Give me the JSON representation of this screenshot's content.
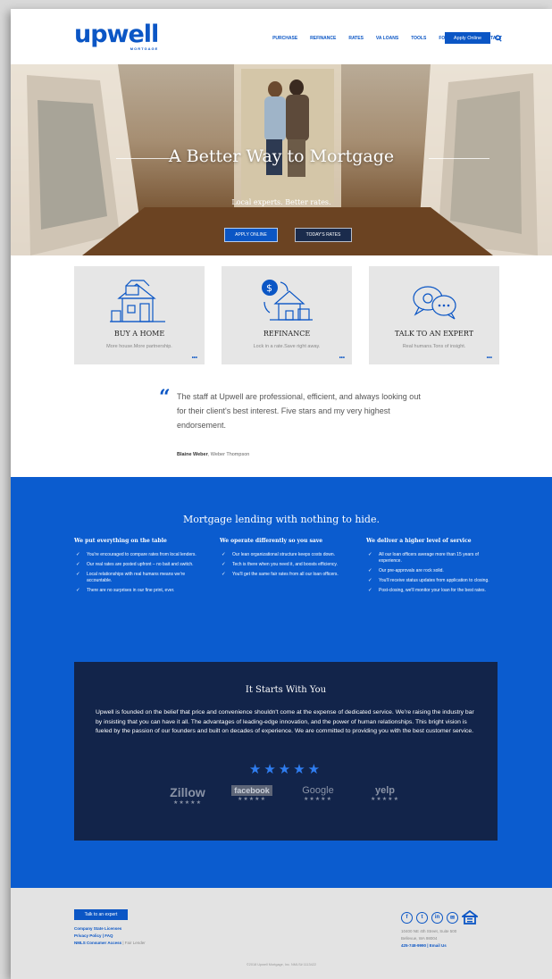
{
  "brand": {
    "name": "upwell",
    "sub": "MORTGAGE",
    "color": "#0b56c5"
  },
  "nav": {
    "items": [
      "PURCHASE",
      "REFINANCE",
      "RATES",
      "VA LOANS",
      "TOOLS",
      "FOR AGENTS",
      "CONTACT"
    ],
    "cta": "Apply Online",
    "search_icon": "search-icon"
  },
  "hero": {
    "title": "A Better Way to Mortgage",
    "subtitle": "Local experts. Better rates.",
    "apply_label": "APPLY ONLINE",
    "rates_label": "TODAY'S RATES"
  },
  "cards": [
    {
      "title": "BUY A HOME",
      "text": "More house.More partnership.",
      "icon": "house-icon"
    },
    {
      "title": "REFINANCE",
      "text": "Lock in a rate.Save right away.",
      "icon": "refinance-icon"
    },
    {
      "title": "TALK TO AN EXPERT",
      "text": "Real humans.Tons of insight.",
      "icon": "chat-icon"
    }
  ],
  "testimonial": {
    "text": "The staff at Upwell are professional, efficient, and always looking out for their client's best interest. Five stars and my very highest endorsement.",
    "author": "Blaine Weber",
    "company": ", Weber Thompson"
  },
  "lending": {
    "title": "Mortgage lending with nothing to hide.",
    "columns": [
      {
        "heading": "We put everything on the table",
        "items": [
          "You're encouraged to compare rates from local lenders.",
          "Our real rates are posted upfront – no bait and switch.",
          "Local relationships with real humans means we're accountable.",
          "There are no surprises in our fine print, ever."
        ]
      },
      {
        "heading": "We operate differently so you save",
        "items": [
          "Our lean organizational structure keeps costs down.",
          "Tech is there when you need it, and boosts efficiency.",
          "You'll get the same fair rates from all our loan officers."
        ]
      },
      {
        "heading": "We deliver a higher level of service",
        "items": [
          "All our loan officers average more than 15 years of experience.",
          "Our pre-approvals are rock solid.",
          "You'll receive status updates from application to closing.",
          "Post-closing, we'll monitor your loan for the best rates."
        ]
      }
    ]
  },
  "starts": {
    "title": "It Starts With You",
    "text": "Upwell is founded on the belief that price and convenience shouldn't come at the expense of dedicated service. We're raising the industry bar by insisting that you can have it all. The advantages of leading-edge innovation, and the power of human relationships. This bright vision is fueled by the passion of our founders and built on decades of experience. We are committed to providing you with the best customer service.",
    "stars": "★★★★★",
    "rating": 5,
    "reviews": [
      {
        "name": "Zillow",
        "stars": "★★★★★"
      },
      {
        "name": "facebook",
        "stars": "★★★★★"
      },
      {
        "name": "Google",
        "stars": "★★★★★"
      },
      {
        "name": "yelp",
        "stars": "★★★★★"
      }
    ]
  },
  "footer": {
    "button": "Talk to an expert",
    "links": [
      "Company State Licenses",
      "Privacy Policy | FAQ",
      "NMLS Consumer Access"
    ],
    "fair": " | Fair Lender",
    "socials": [
      "f",
      "t",
      "in",
      "✉"
    ],
    "address1": "10400 NE 4th Street, Suite 500",
    "address2": "Bellevue, WA 98004",
    "phone": "425-748-9990",
    "email": " | Email Us",
    "copyright": "©2018 Upwell Mortgage, Inc. NMLS# 1113422"
  }
}
